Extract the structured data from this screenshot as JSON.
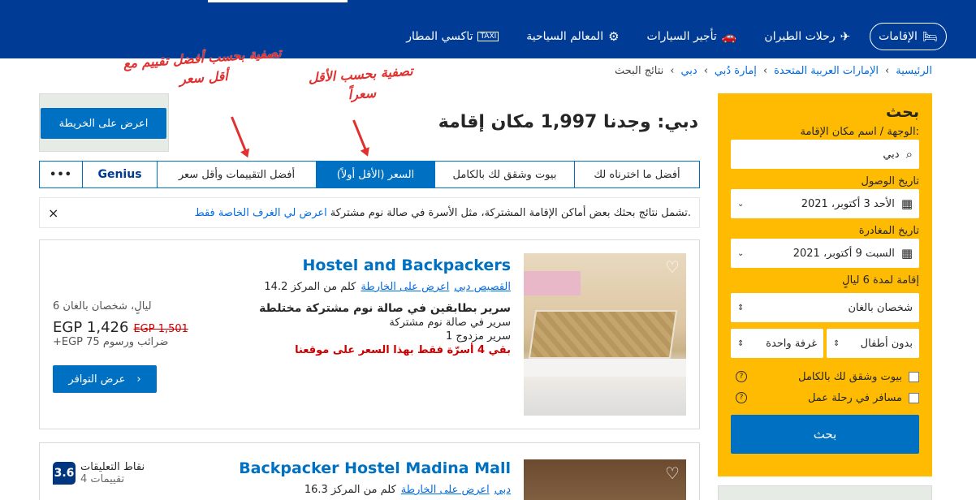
{
  "nav": {
    "items": [
      {
        "label": "الإقامات",
        "icon": "bed-icon"
      },
      {
        "label": "رحلات الطيران",
        "icon": "plane-icon"
      },
      {
        "label": "تأجير السيارات",
        "icon": "car-icon"
      },
      {
        "label": "المعالم السياحية",
        "icon": "attractions-icon"
      },
      {
        "label": "تاكسي المطار",
        "icon": "taxi-icon"
      }
    ]
  },
  "breadcrumb": [
    "الرئيسية",
    "الإمارات العربية المتحدة",
    "إمارة دُبي",
    "دبي",
    "نتائج البحث"
  ],
  "search": {
    "title": "بحث",
    "dest_label": "الوجهة / اسم مكان الإقامة:",
    "dest_value": "دبي",
    "checkin_label": "تاريخ الوصول",
    "checkin_value": "الأحد 3 أكتوبر، 2021",
    "checkout_label": "تاريخ المغادرة",
    "checkout_value": "السبت 9 أكتوبر، 2021",
    "stay_label": "إقامة لمدة 6 ليالٍ",
    "guests_value": "شخصان بالغان",
    "children_value": "بدون أطفال",
    "rooms_value": "غرفة واحدة",
    "check_homes": "بيوت وشقق لك بالكامل",
    "check_business": "مسافر في رحلة عمل",
    "button": "بحث"
  },
  "map_button": "اعرض على الخريطة",
  "results_title": "دبي: وجدنا 1,997 مكان إقامة",
  "tabs": [
    {
      "label": "أفضل ما اخترناه لك"
    },
    {
      "label": "بيوت وشقق لك بالكامل"
    },
    {
      "label": "السعر (الأقل أولاً)"
    },
    {
      "label": "أفضل التقييمات وأقل سعر"
    },
    {
      "label": "Genius"
    },
    {
      "label": "•••"
    }
  ],
  "notice": {
    "text": "تشمل نتائج بحثك بعض أماكن الإقامة المشتركة، مثل الأسرة في صالة نوم مشتركة.",
    "link": "اعرض لي الغرف الخاصة فقط",
    "close": "×"
  },
  "hotels": [
    {
      "name": "Hostel and Backpackers",
      "area": "القصيص دبي",
      "map_link": "اعرض على الخارطة",
      "distance": "14.2 كلم من المركز",
      "room_type": "سرير بطابقين في صالة نوم مشتركة مختلطة",
      "room_desc1": "سرير في صالة نوم مشتركة",
      "room_desc2": "1 سرير مزدوج",
      "warning": "بقي 4 أسرّة فقط بهذا السعر على موقعنا",
      "nights": "6 ليالٍ، شخصان بالغان",
      "price": "EGP 1,426",
      "old_price": "EGP 1,501",
      "taxes": "+EGP 75 ضرائب ورسوم",
      "button": "عرض التوافر"
    },
    {
      "name": "Backpacker Hostel Madina Mall",
      "area": "دبي",
      "map_link": "اعرض على الخارطة",
      "distance": "16.3 كلم من المركز",
      "score": "3.6",
      "score_label": "نقاط التعليقات",
      "reviews": "4 تقييمات"
    }
  ],
  "annotations": {
    "a1": "تصفية بحسب أفضل تقييم مع أقل سعر",
    "a2": "تصفية بحسب الأقل سعراً"
  }
}
